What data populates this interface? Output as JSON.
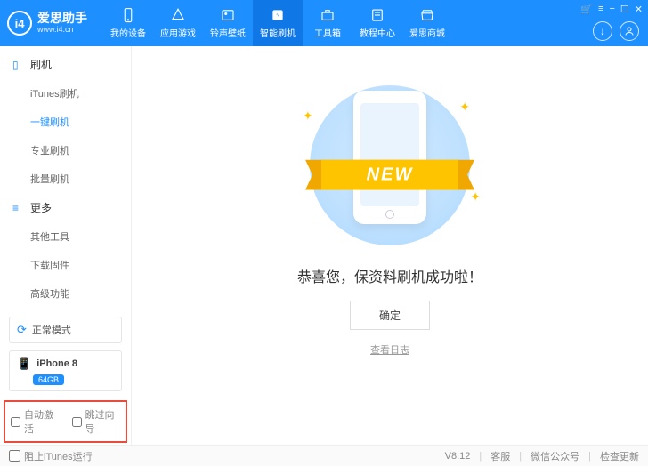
{
  "app": {
    "name": "爱思助手",
    "url": "www.i4.cn"
  },
  "nav": [
    {
      "icon": "phone",
      "label": "我的设备"
    },
    {
      "icon": "apps",
      "label": "应用游戏"
    },
    {
      "icon": "ring",
      "label": "铃声壁纸"
    },
    {
      "icon": "flash",
      "label": "智能刷机",
      "active": true
    },
    {
      "icon": "toolbox",
      "label": "工具箱"
    },
    {
      "icon": "tutorial",
      "label": "教程中心"
    },
    {
      "icon": "store",
      "label": "爱思商城"
    }
  ],
  "window_controls": [
    "🛒",
    "≡",
    "−",
    "☐",
    "✕"
  ],
  "sidebar": {
    "sections": [
      {
        "title": "刷机",
        "icon": "phone",
        "items": [
          {
            "label": "iTunes刷机"
          },
          {
            "label": "一键刷机",
            "active": true
          },
          {
            "label": "专业刷机"
          },
          {
            "label": "批量刷机"
          }
        ]
      },
      {
        "title": "更多",
        "icon": "more",
        "items": [
          {
            "label": "其他工具"
          },
          {
            "label": "下载固件"
          },
          {
            "label": "高级功能"
          }
        ]
      }
    ],
    "mode": "正常模式",
    "device": {
      "name": "iPhone 8",
      "capacity": "64GB"
    },
    "options": {
      "auto_activate": "自动激活",
      "skip_guide": "跳过向导"
    }
  },
  "main": {
    "ribbon_text": "NEW",
    "message": "恭喜您，保资料刷机成功啦！",
    "confirm": "确定",
    "view_log": "查看日志"
  },
  "footer": {
    "block_itunes": "阻止iTunes运行",
    "version": "V8.12",
    "links": [
      "客服",
      "微信公众号",
      "检查更新"
    ]
  }
}
